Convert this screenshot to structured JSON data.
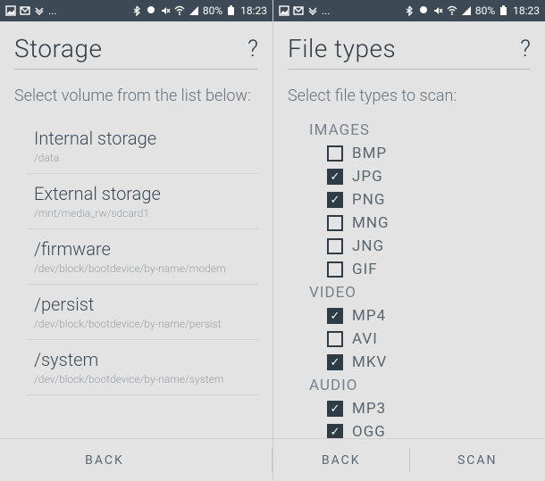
{
  "status": {
    "time": "18:23",
    "battery": "80%",
    "ellipsis": "..."
  },
  "left": {
    "title": "Storage",
    "help": "?",
    "subtitle": "Select volume from the list below:",
    "volumes": [
      {
        "name": "Internal storage",
        "path": "/data"
      },
      {
        "name": "External storage",
        "path": "/mnt/media_rw/sdcard1"
      },
      {
        "name": "/firmware",
        "path": "/dev/block/bootdevice/by-name/modem"
      },
      {
        "name": "/persist",
        "path": "/dev/block/bootdevice/by-name/persist"
      },
      {
        "name": "/system",
        "path": "/dev/block/bootdevice/by-name/system"
      }
    ],
    "back": "BACK"
  },
  "right": {
    "title": "File types",
    "help": "?",
    "subtitle": "Select file types to scan:",
    "groups": [
      {
        "label": "IMAGES",
        "types": [
          {
            "label": "BMP",
            "checked": false
          },
          {
            "label": "JPG",
            "checked": true
          },
          {
            "label": "PNG",
            "checked": true
          },
          {
            "label": "MNG",
            "checked": false
          },
          {
            "label": "JNG",
            "checked": false
          },
          {
            "label": "GIF",
            "checked": false
          }
        ]
      },
      {
        "label": "VIDEO",
        "types": [
          {
            "label": "MP4",
            "checked": true
          },
          {
            "label": "AVI",
            "checked": false
          },
          {
            "label": "MKV",
            "checked": true
          }
        ]
      },
      {
        "label": "AUDIO",
        "types": [
          {
            "label": "MP3",
            "checked": true
          },
          {
            "label": "OGG",
            "checked": true
          }
        ]
      }
    ],
    "back": "BACK",
    "scan": "SCAN"
  }
}
